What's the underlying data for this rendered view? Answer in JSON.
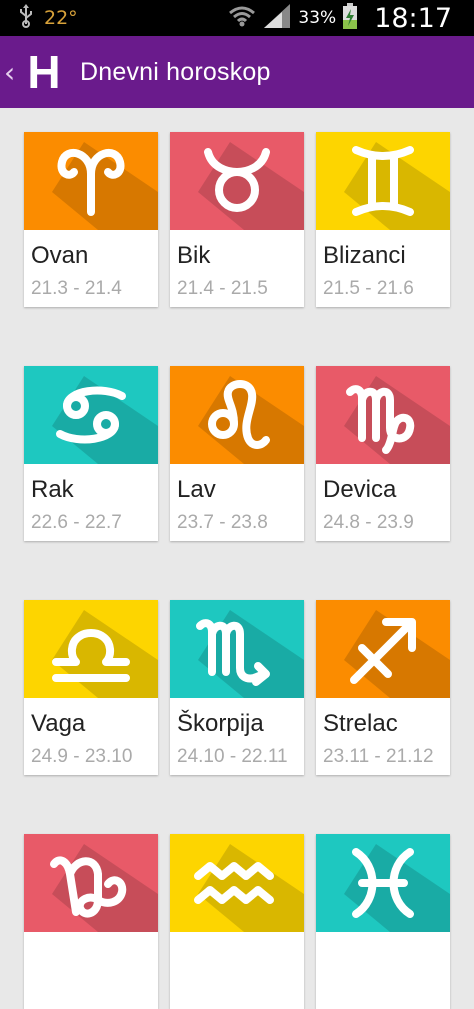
{
  "status": {
    "temperature": "22°",
    "battery_percent": "33%",
    "time": "18:17"
  },
  "appbar": {
    "logo": "H",
    "title": "Dnevni horoskop"
  },
  "signs": [
    {
      "name": "Ovan",
      "dates": "21.3 - 21.4",
      "color": "#fb8c00",
      "icon": "aries-icon"
    },
    {
      "name": "Bik",
      "dates": "21.4 - 21.5",
      "color": "#e85a68",
      "icon": "taurus-icon"
    },
    {
      "name": "Blizanci",
      "dates": "21.5 - 21.6",
      "color": "#fdd500",
      "icon": "gemini-icon"
    },
    {
      "name": "Rak",
      "dates": "22.6 - 22.7",
      "color": "#1ec8c0",
      "icon": "cancer-icon"
    },
    {
      "name": "Lav",
      "dates": "23.7 - 23.8",
      "color": "#fb8c00",
      "icon": "leo-icon"
    },
    {
      "name": "Devica",
      "dates": "24.8 - 23.9",
      "color": "#e85a68",
      "icon": "virgo-icon"
    },
    {
      "name": "Vaga",
      "dates": "24.9 - 23.10",
      "color": "#fdd500",
      "icon": "libra-icon"
    },
    {
      "name": "Škorpija",
      "dates": "24.10 - 22.11",
      "color": "#1ec8c0",
      "icon": "scorpio-icon"
    },
    {
      "name": "Strelac",
      "dates": "23.11 - 21.12",
      "color": "#fb8c00",
      "icon": "sagittarius-icon"
    },
    {
      "name": "",
      "dates": "",
      "color": "#e85a68",
      "icon": "capricorn-icon"
    },
    {
      "name": "",
      "dates": "",
      "color": "#fdd500",
      "icon": "aquarius-icon"
    },
    {
      "name": "",
      "dates": "",
      "color": "#1ec8c0",
      "icon": "pisces-icon"
    }
  ]
}
